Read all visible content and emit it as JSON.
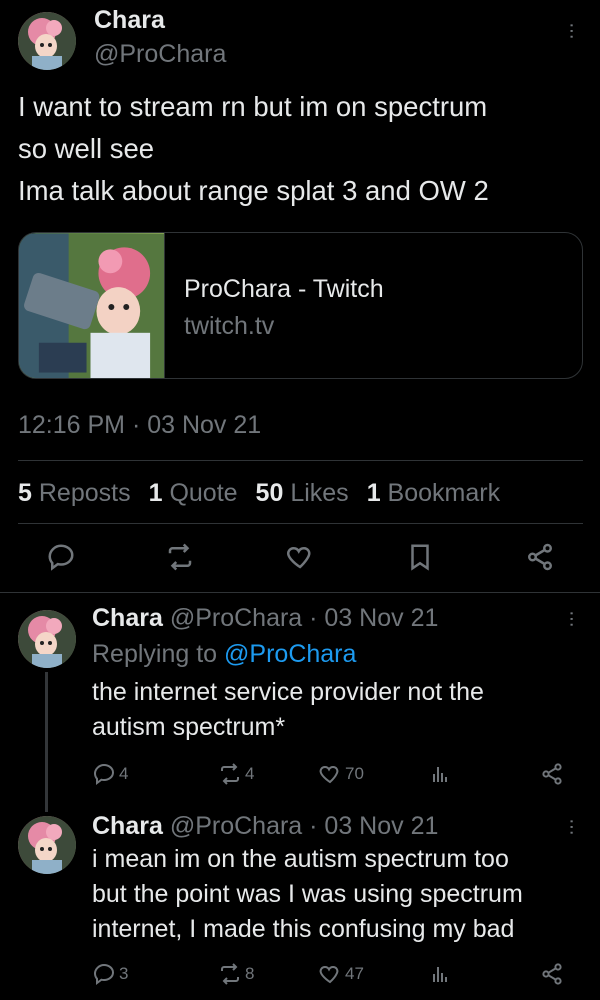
{
  "main_tweet": {
    "author_name": "Chara",
    "author_handle": "@ProChara",
    "text_lines": [
      "I want to stream rn but im on spectrum",
      "so well see",
      "Ima talk about range splat 3 and OW 2"
    ],
    "link_card": {
      "title": "ProChara - Twitch",
      "domain": "twitch.tv"
    },
    "timestamp": "12:16 PM · 03 Nov 21",
    "stats": {
      "reposts_count": "5",
      "reposts_label": "Reposts",
      "quotes_count": "1",
      "quotes_label": "Quote",
      "likes_count": "50",
      "likes_label": "Likes",
      "bookmarks_count": "1",
      "bookmarks_label": "Bookmark"
    },
    "icons": [
      "reply-icon",
      "repost-icon",
      "like-icon",
      "bookmark-icon",
      "share-icon"
    ]
  },
  "replies": [
    {
      "name": "Chara",
      "meta": "@ProChara · 03 Nov 21",
      "replying_to_label": "Replying to",
      "replying_to_handle": "@ProChara",
      "text_lines": [
        "the internet service provider not the",
        "autism spectrum*"
      ],
      "replies": "4",
      "reposts": "4",
      "likes": "70"
    },
    {
      "name": "Chara",
      "meta": "@ProChara · 03 Nov 21",
      "text_lines": [
        "i mean im on the autism spectrum too",
        "but the point was I was using spectrum",
        "internet, I made this confusing my bad"
      ],
      "replies": "3",
      "reposts": "8",
      "likes": "47"
    }
  ],
  "colors": {
    "background": "#000000",
    "text": "#e7e9ea",
    "muted": "#71767b",
    "link": "#1d9bf0",
    "border": "#2f3336"
  }
}
